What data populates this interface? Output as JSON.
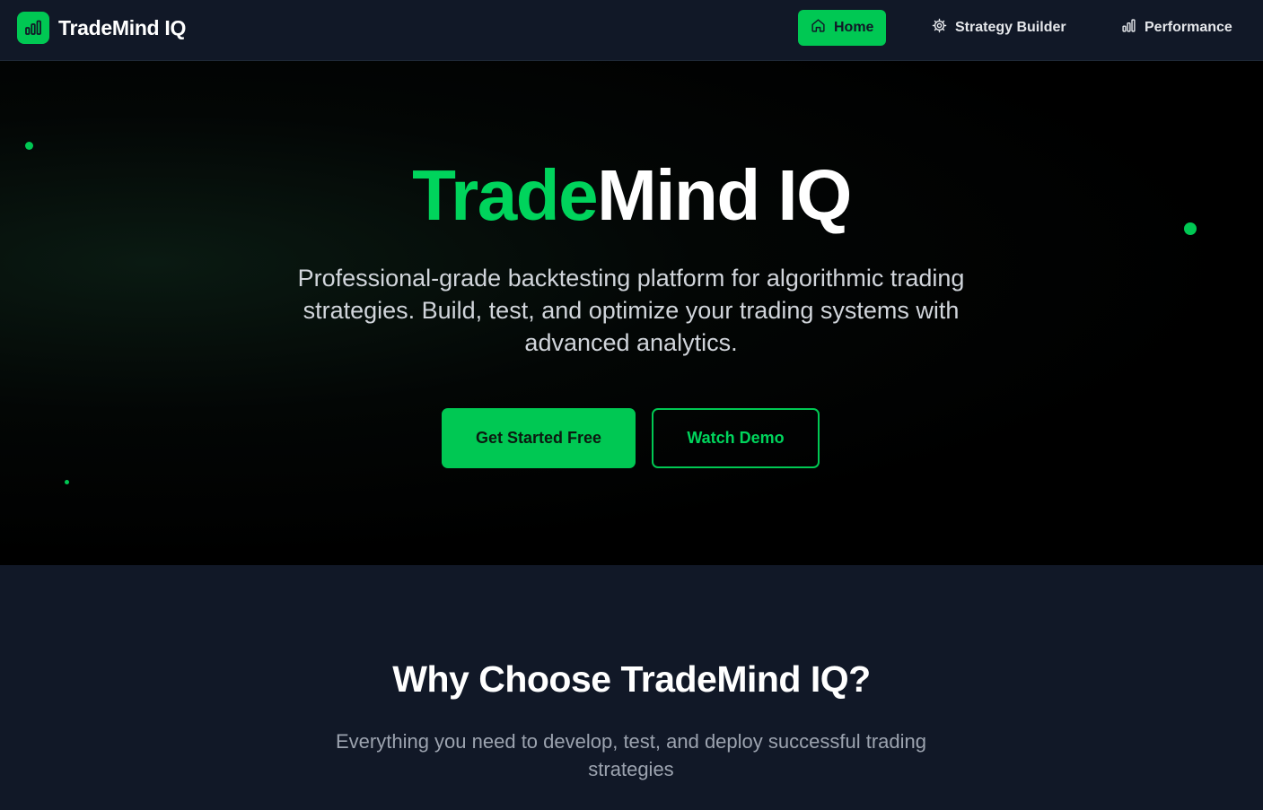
{
  "nav": {
    "brand": "TradeMind IQ",
    "logo_icon": "bar-chart-icon",
    "items": [
      {
        "label": "Home",
        "icon": "home-icon",
        "active": true
      },
      {
        "label": "Strategy Builder",
        "icon": "gear-icon",
        "active": false
      },
      {
        "label": "Performance",
        "icon": "bar-chart-icon",
        "active": false
      }
    ]
  },
  "hero": {
    "title_accent": "Trade",
    "title_rest": "Mind IQ",
    "subtitle": "Professional-grade backtesting platform for algorithmic trading strategies. Build, test, and optimize your trading systems with advanced analytics.",
    "primary_cta": "Get Started Free",
    "secondary_cta": "Watch Demo"
  },
  "features": {
    "title": "Why Choose TradeMind IQ?",
    "subtitle": "Everything you need to develop, test, and deploy successful trading strategies"
  },
  "colors": {
    "accent": "#00c853",
    "nav_bg": "#111827",
    "hero_bg": "#000000"
  }
}
